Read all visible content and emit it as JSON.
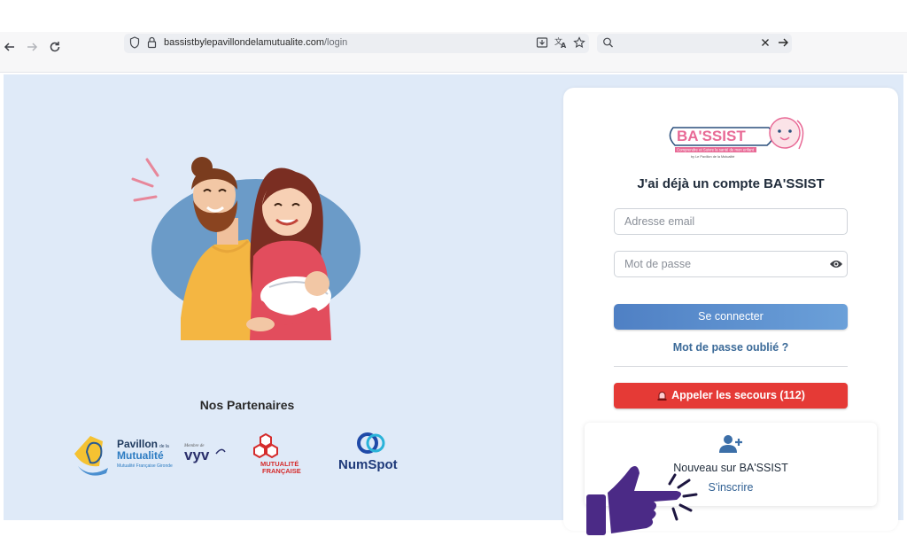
{
  "browser": {
    "url_domain": "bassistbylepavillondelamutualite.com",
    "url_path": "/login",
    "search_value": ""
  },
  "partners": {
    "title": "Nos Partenaires",
    "logos": [
      {
        "name": "Pavillon de la Mutualité",
        "line1": "Pavillon",
        "line1_small": "de la",
        "line2": "Mutualité",
        "line3": "Mutualité Française Gironde"
      },
      {
        "name": "VYV",
        "small": "Membre de",
        "text": "vyv"
      },
      {
        "name": "Mutualité Française",
        "line1": "MUTUALITÉ",
        "line2": "FRANÇAISE"
      },
      {
        "name": "NumSpot",
        "text": "NumSpot"
      }
    ]
  },
  "login": {
    "logo_text": "BA'SSIST",
    "logo_tagline": "Comprendre et Suivre la santé de mon enfant",
    "logo_sub": "by Le Pavillon de la Mutualité",
    "title": "J'ai déjà un compte BA'SSIST",
    "email_placeholder": "Adresse email",
    "password_placeholder": "Mot de passe",
    "submit_label": "Se connecter",
    "forgot_label": "Mot de passe oublié ?",
    "emergency_label": "Appeler les secours (112)",
    "signup_prompt": "Nouveau sur BA'SSIST",
    "signup_link": "S'inscrire"
  },
  "colors": {
    "page_bg": "#dfeaf8",
    "primary": "#4f80c4",
    "emergency": "#e53a36",
    "link": "#3b6a98",
    "pointer_hand": "#4b2a86"
  }
}
